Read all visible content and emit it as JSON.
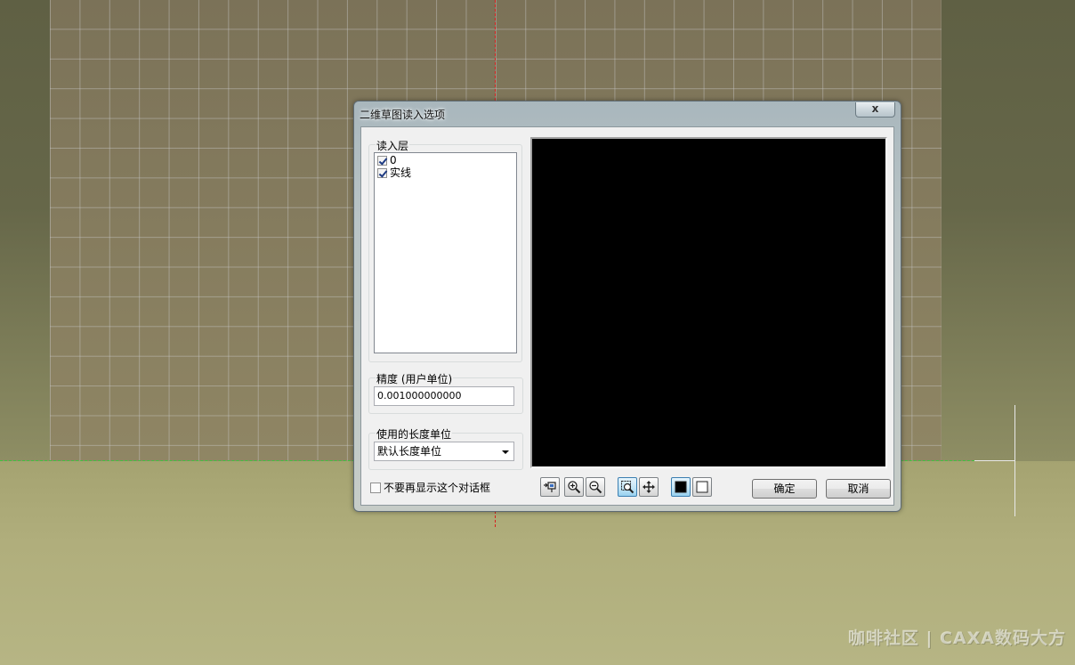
{
  "dialog": {
    "title": "二维草图读入选项",
    "close_label": "x",
    "layer_group_label": "读入层",
    "layers": [
      {
        "name": "0",
        "checked": true
      },
      {
        "name": "实线",
        "checked": true
      }
    ],
    "precision_label": "精度 (用户单位)",
    "precision_value": "0.001000000000",
    "length_unit_label": "使用的长度单位",
    "length_unit_selected": "默认长度单位",
    "dont_show_again_label": "不要再显示这个对话框",
    "dont_show_again_checked": false,
    "ok_label": "确定",
    "cancel_label": "取消",
    "toolbar_icons": [
      "fit-view-icon",
      "zoom-in-icon",
      "zoom-out-icon",
      "zoom-window-icon",
      "pan-icon",
      "black-background-icon",
      "white-background-icon"
    ]
  },
  "watermark": "咖啡社区 | CAXA数码大方",
  "colors": {
    "preview_background": "#000000",
    "axis_x": "#d81e1e",
    "axis_y": "#3ec43e",
    "active_tool": "#98d1ef"
  }
}
